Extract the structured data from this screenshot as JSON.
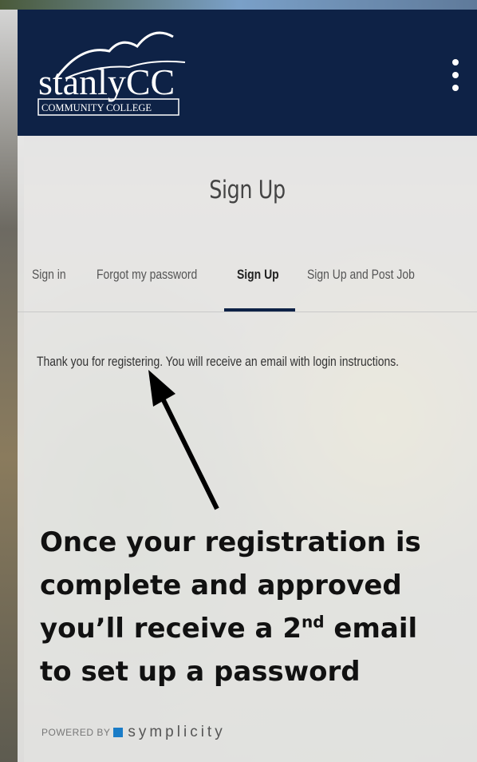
{
  "header": {
    "logo_text_main": "stanlyCC",
    "logo_text_sub": "COMMUNITY COLLEGE",
    "menu_icon": "kebab-menu-icon"
  },
  "page": {
    "title": "Sign Up"
  },
  "tabs": [
    {
      "label": "Sign in",
      "active": false
    },
    {
      "label": "Forgot my password",
      "active": false
    },
    {
      "label": "Sign Up",
      "active": true
    },
    {
      "label": "Sign Up and Post Job",
      "active": false
    }
  ],
  "message": "Thank you for registering. You will receive an email with login instructions.",
  "annotation": {
    "line1": "Once your registration is",
    "line2": "complete and approved",
    "line3_pre": "you’ll receive a 2",
    "line3_sup": "nd",
    "line3_post": " email",
    "line4": "to set up a password"
  },
  "footer": {
    "powered_by": "POWERED BY",
    "brand": "symplicity"
  },
  "colors": {
    "header_bg": "#0e2246",
    "accent": "#1a7cc7"
  }
}
